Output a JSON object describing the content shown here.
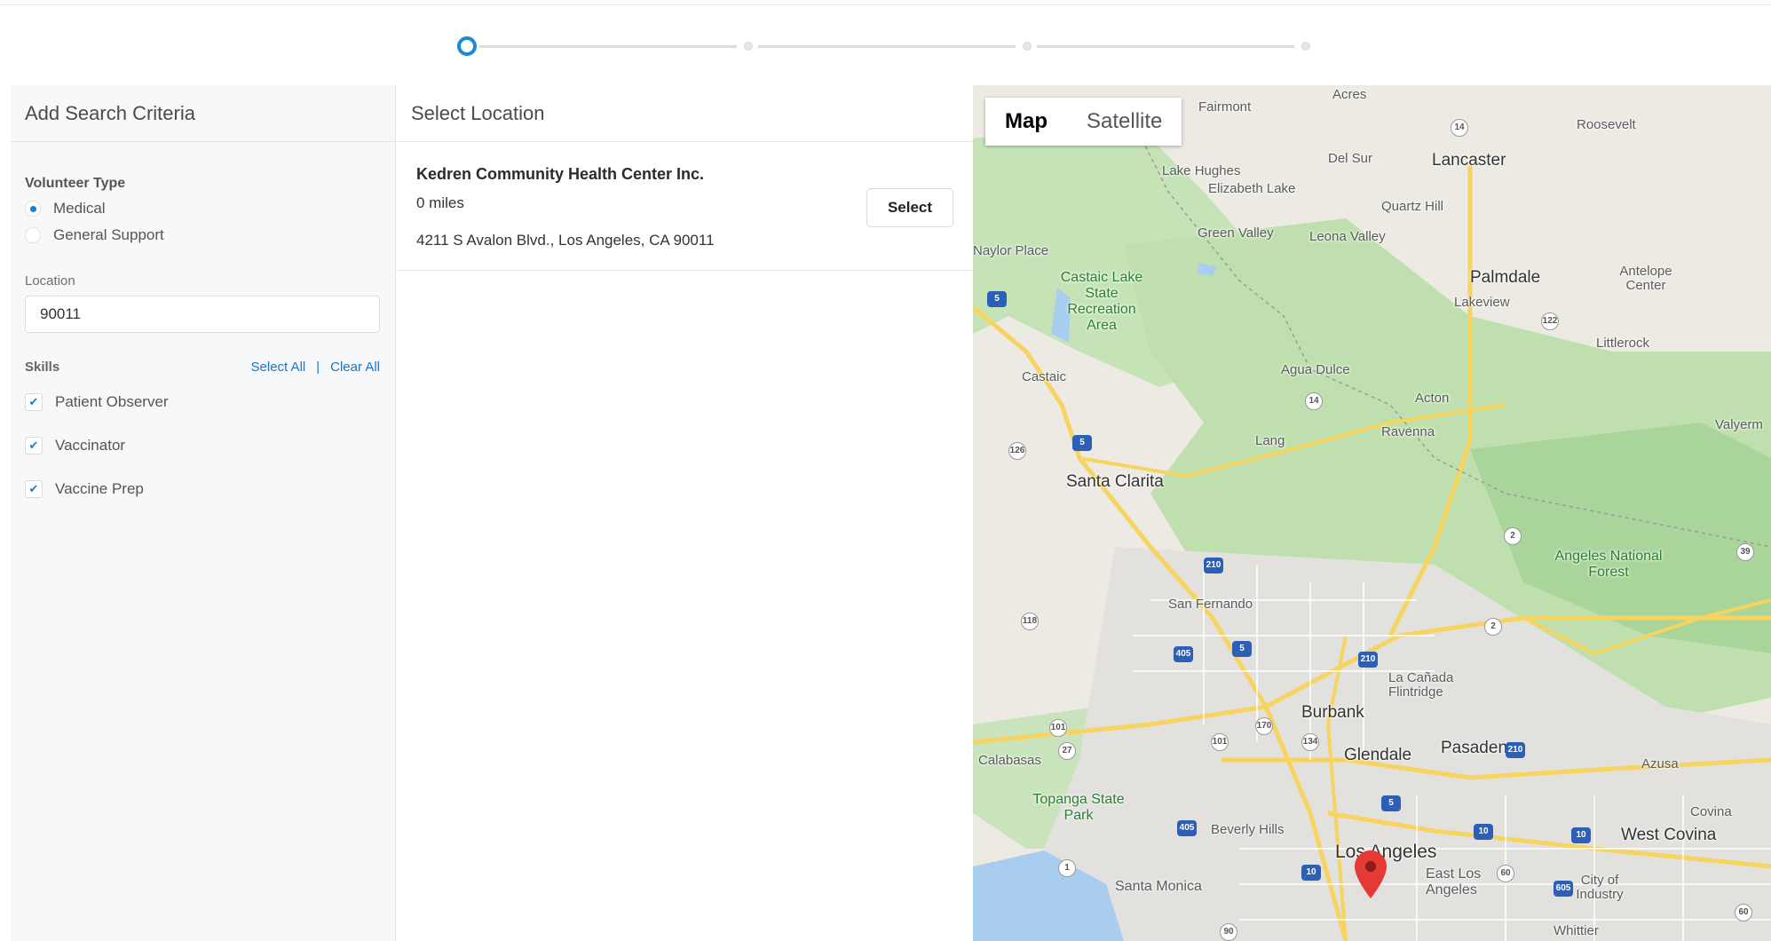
{
  "stepper": {
    "current_step": 1,
    "total_steps": 4
  },
  "left_panel": {
    "title": "Add Search Criteria",
    "volunteer_type_label": "Volunteer Type",
    "volunteer_types": [
      {
        "label": "Medical",
        "selected": true
      },
      {
        "label": "General Support",
        "selected": false
      }
    ],
    "location_label": "Location",
    "location_value": "90011",
    "skills_label": "Skills",
    "select_all": "Select All",
    "separator": "|",
    "clear_all": "Clear All",
    "skills": [
      {
        "label": "Patient Observer",
        "checked": true
      },
      {
        "label": "Vaccinator",
        "checked": true
      },
      {
        "label": "Vaccine Prep",
        "checked": true
      }
    ]
  },
  "middle_panel": {
    "title": "Select Location",
    "results": [
      {
        "name": "Kedren Community Health Center Inc.",
        "distance": "0 miles",
        "address": "4211 S Avalon Blvd., Los Angeles, CA 90011",
        "button": "Select"
      }
    ]
  },
  "map": {
    "toggle_map": "Map",
    "toggle_satellite": "Satellite",
    "places": {
      "fairmont": "Fairmont",
      "acres": "Acres",
      "roosevelt": "Roosevelt",
      "lake_hughes": "Lake Hughes",
      "elizabeth_lake": "Elizabeth Lake",
      "del_sur": "Del Sur",
      "lancaster": "Lancaster",
      "quartz_hill": "Quartz Hill",
      "green_valley": "Green Valley",
      "leona_valley": "Leona Valley",
      "naylor_place": "Naylor Place",
      "castaic_lake": "Castaic Lake State Recreation Area",
      "palmdale": "Palmdale",
      "antelope_center": "Antelope Center",
      "lakeview": "Lakeview",
      "littlerock": "Littlerock",
      "castaic": "Castaic",
      "agua_dulce": "Agua Dulce",
      "acton": "Acton",
      "lang": "Lang",
      "ravenna": "Ravenna",
      "valyermo": "Valyerm",
      "santa_clarita": "Santa Clarita",
      "angeles_nf": "Angeles National Forest",
      "san_fernando": "San Fernando",
      "la_canada": "La Cañada Flintridge",
      "burbank": "Burbank",
      "glendale": "Glendale",
      "pasadena": "Pasadena",
      "azusa": "Azusa",
      "calabasas": "Calabasas",
      "topanga": "Topanga State Park",
      "beverly_hills": "Beverly Hills",
      "covina": "Covina",
      "west_covina": "West Covina",
      "los_angeles": "Los Angeles",
      "east_la": "East Los Angeles",
      "city_of_industry": "City of Industry",
      "santa_monica": "Santa Monica",
      "whittier": "Whittier"
    },
    "marker_icon": "map-pin-icon"
  }
}
